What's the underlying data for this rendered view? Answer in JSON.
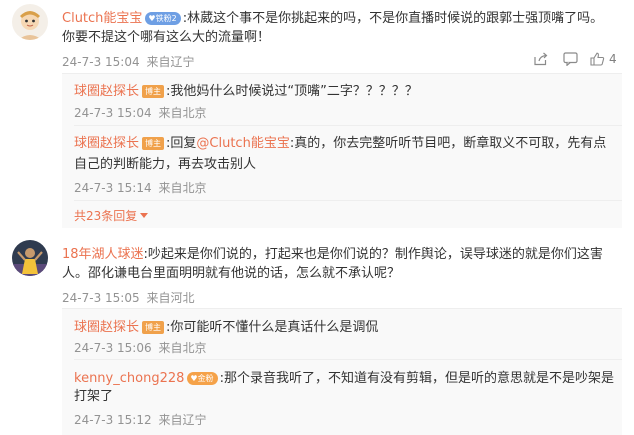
{
  "comment1": {
    "username": "Clutch能宝宝",
    "fan_badge": "铁粉2",
    "text_line1": ":林葳这个事不是你挑起来的吗，不是你直播时候说的跟郭士强顶嘴了吗。",
    "text_line2": "你要不提这个哪有这么大的流量啊！",
    "time": "24-7-3 15:04",
    "location": "来自辽宁",
    "like_count": "4",
    "replies": [
      {
        "username": "球圈赵探长",
        "badge": "博主",
        "text_line1": ":我他妈什么时候说过“顶嘴”二字？？？？？",
        "time": "24-7-3 15:04",
        "location": "来自北京"
      },
      {
        "username": "球圈赵探长",
        "badge": "博主",
        "prefix": ":回复",
        "mention": "@Clutch能宝宝",
        "text_line1_rest": ":真的，你去完整听听节目吧，断章取义不可取，先有点",
        "text_line2": "自己的判断能力，再去攻击别人",
        "time": "24-7-3 15:14",
        "location": "来自北京"
      }
    ],
    "more_replies": "共23条回复"
  },
  "comment2": {
    "username": "18年湖人球迷",
    "text_line1": ":吵起来是你们说的，打起来也是你们说的？制作舆论，误导球迷的就是你们这害",
    "text_line2": "人。邵化谦电台里面明明就有他说的话，怎么就不承认呢？",
    "time": "24-7-3 15:05",
    "location": "来自河北",
    "replies": [
      {
        "username": "球圈赵探长",
        "badge": "博主",
        "text_line1": ":你可能听不懂什么是真话什么是调侃",
        "time": "24-7-3 15:06",
        "location": "来自北京"
      },
      {
        "username": "kenny_chong228",
        "fan_badge": "金粉",
        "text_line1": ":那个录音我听了，不知道有没有剪辑，但是听的意思就是不是吵架是",
        "text_line2": "打架了",
        "time": "24-7-3 15:12",
        "location": "来自辽宁"
      }
    ]
  },
  "icons": {
    "share": "share-icon",
    "comment": "comment-icon",
    "like": "like-icon"
  },
  "colors": {
    "username": "#eb7350",
    "blogger_badge": "#f0a14b",
    "fan_badge": "#6e9fe4",
    "gold_fan_badge": "#f5a249",
    "reply_bg": "#f9f9f9"
  }
}
